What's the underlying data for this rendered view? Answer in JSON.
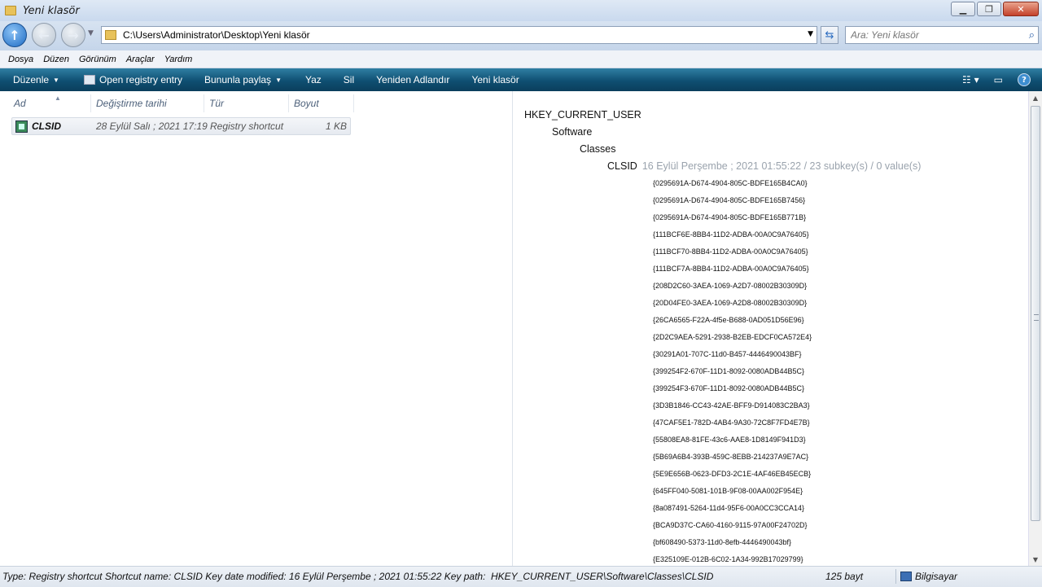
{
  "window": {
    "title": "Yeni klasör"
  },
  "address": {
    "path": "C:\\Users\\Administrator\\Desktop\\Yeni klasör"
  },
  "search": {
    "placeholder": "Ara: Yeni klasör"
  },
  "menu": [
    "Dosya",
    "Düzen",
    "Görünüm",
    "Araçlar",
    "Yardım"
  ],
  "toolbar": {
    "organize": "Düzenle",
    "open_registry": "Open registry entry",
    "share": "Bununla paylaş",
    "write": "Yaz",
    "delete": "Sil",
    "rename": "Yeniden Adlandır",
    "new_folder": "Yeni klasör"
  },
  "columns": {
    "name": "Ad",
    "modified": "Değiştirme tarihi",
    "type": "Tür",
    "size": "Boyut"
  },
  "files": [
    {
      "name": "CLSID",
      "modified": "28 Eylül Salı ; 2021 17:19",
      "type": "Registry shortcut",
      "size": "1 KB"
    }
  ],
  "preview": {
    "root": "HKEY_CURRENT_USER",
    "level1": "Software",
    "level2": "Classes",
    "key": "CLSID",
    "key_meta": "16 Eylül Perşembe ; 2021 01:55:22 / 23 subkey(s) / 0 value(s)",
    "subkeys": [
      "{0295691A-D674-4904-805C-BDFE165B4CA0}",
      "{0295691A-D674-4904-805C-BDFE165B7456}",
      "{0295691A-D674-4904-805C-BDFE165B771B}",
      "{111BCF6E-8BB4-11D2-ADBA-00A0C9A76405}",
      "{111BCF70-8BB4-11D2-ADBA-00A0C9A76405}",
      "{111BCF7A-8BB4-11D2-ADBA-00A0C9A76405}",
      "{208D2C60-3AEA-1069-A2D7-08002B30309D}",
      "{20D04FE0-3AEA-1069-A2D8-08002B30309D}",
      "{26CA6565-F22A-4f5e-B688-0AD051D56E96}",
      "{2D2C9AEA-5291-2938-B2EB-EDCF0CA572E4}",
      "{30291A01-707C-11d0-B457-4446490043BF}",
      "{399254F2-670F-11D1-8092-0080ADB44B5C}",
      "{399254F3-670F-11D1-8092-0080ADB44B5C}",
      "{3D3B1846-CC43-42AE-BFF9-D914083C2BA3}",
      "{47CAF5E1-782D-4AB4-9A30-72C8F7FD4E7B}",
      "{55808EA8-81FE-43c6-AAE8-1D8149F941D3}",
      "{5B69A6B4-393B-459C-8EBB-214237A9E7AC}",
      "{5E9E656B-0623-DFD3-2C1E-4AF46EB45ECB}",
      "{645FF040-5081-101B-9F08-00AA002F954E}",
      "{8a087491-5264-11d4-95F6-00A0CC3CCA14}",
      "{BCA9D37C-CA60-4160-9115-97A00F24702D}",
      "{bf608490-5373-11d0-8efb-4446490043bf}",
      "{E325109E-012B-6C02-1A34-992B17029799}"
    ]
  },
  "status": {
    "info": "Type: Registry shortcut  Shortcut name: CLSID  Key date modified: 16 Eylül Perşembe ; 2021 01:55:22  Key path:",
    "path": "HKEY_CURRENT_USER\\Software\\Classes\\CLSID",
    "size": "125 bayt",
    "computer": "Bilgisayar"
  },
  "icons": {
    "nav_up": "arrow-up-icon",
    "nav_back": "arrow-left-icon",
    "nav_forward": "arrow-right-icon",
    "refresh": "refresh-icon",
    "search": "magnifier-icon",
    "help": "help-icon"
  }
}
